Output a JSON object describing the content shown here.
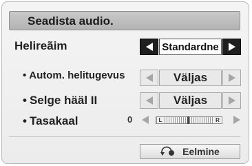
{
  "title": "Seadista audio.",
  "rows": {
    "sound_mode": {
      "label": "Helireãim",
      "value": "Standardne"
    },
    "auto_volume": {
      "label": "Autom. helitugevus",
      "value": "Väljas"
    },
    "clear_voice": {
      "label": "Selge hääl II",
      "value": "Väljas"
    },
    "balance": {
      "label": "Tasakaal",
      "value": "0",
      "left_tag": "L",
      "right_tag": "R",
      "level": 0
    }
  },
  "bullet": "•",
  "back_button": {
    "label": "Eelmine",
    "icon": "return-icon"
  },
  "colors": {
    "title_bar": "#bdbdbd",
    "arrow_active": "#1f1f1f",
    "arrow_dim": "#e9e9e9"
  }
}
